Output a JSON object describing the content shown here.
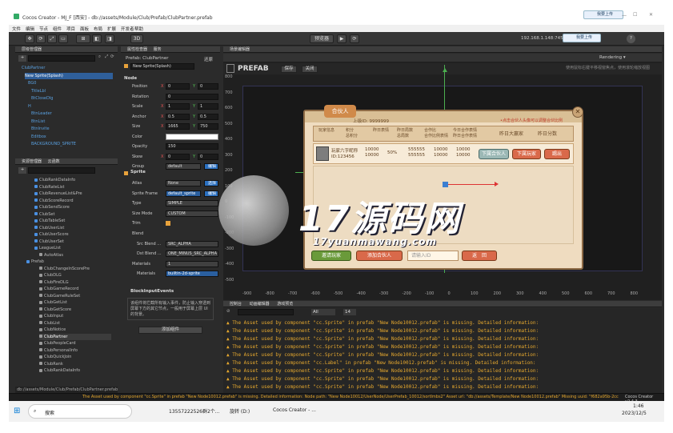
{
  "window": {
    "title": "Cocos Creator - MJ_F [西安] - db://assets/Module/Club/Prefab/ClubPartner.prefab",
    "upload1": "我要上传",
    "upload2": "我要上传"
  },
  "menu": [
    "文件",
    "编辑",
    "节点",
    "组件",
    "项目",
    "面板",
    "布局",
    "扩展",
    "开发者",
    "帮助"
  ],
  "toolbar": {
    "scene_btn": "预览器",
    "ip": "192.168.1.148:7456",
    "play": "▶",
    "refresh": "⟳",
    "zoom3d": "3D"
  },
  "node_tree": {
    "title": "层级管理器",
    "rows": [
      "ClubPartner",
      "New Sprite(Splash)",
      "BG0",
      "TitleLbl",
      "BtCloseDlg",
      "H",
      "BtnLeader",
      "BtnList",
      "BtnInvite",
      "Editbox",
      "BACKGROUND_SPRITE"
    ]
  },
  "assets": {
    "title": "资源管理器",
    "tab2": "云函数",
    "rows": [
      "ClubRankDataInfo",
      "ClubRateList",
      "ClubRevenueList&Pre",
      "ClubScoreRecord",
      "ClubSendScore",
      "ClubSet",
      "ClubTableSet",
      "ClubUserList",
      "ClubUserScore",
      "ClubUserSet",
      "LeagueList",
      "AutoAtlas",
      "Prefab",
      "ClubChangeInScorePre",
      "ClubDLG",
      "ClubFireDLG",
      "ClubGameRecord",
      "ClubGameRuleSet",
      "ClubGetList",
      "ClubGetScore",
      "ClubInput",
      "ClubList",
      "ClubNotice",
      "ClubPartner",
      "ClubPeopleCard",
      "ClubPersonalInfo",
      "ClubQuickJoin",
      "ClubRank",
      "ClubRankDataInfo"
    ],
    "path": "db://assets/Module/Club/Prefab/ClubPartner.prefab"
  },
  "inspector": {
    "tab1": "属性检查器",
    "tab2": "服务",
    "prefab_label": "Prefab: ClubPartner",
    "prefab_btn": "还原",
    "node_name": "New Sprite(Splash)",
    "node_section": "Node",
    "props": [
      {
        "k": "Position",
        "x": "0",
        "y": "0"
      },
      {
        "k": "Rotation",
        "v": "0"
      },
      {
        "k": "Scale",
        "x": "1",
        "y": "1"
      },
      {
        "k": "Anchor",
        "x": "0.5",
        "y": "0.5"
      },
      {
        "k": "Size",
        "x": "1665",
        "y": "750"
      },
      {
        "k": "Color",
        "v": ""
      },
      {
        "k": "Opacity",
        "v": "150"
      },
      {
        "k": "Skew",
        "x": "0",
        "y": "0"
      },
      {
        "k": "Group",
        "v": "default",
        "btn": "编辑"
      }
    ],
    "sprite_section": "Sprite",
    "sprite": [
      {
        "k": "Atlas",
        "v": "None",
        "btn": "选择"
      },
      {
        "k": "Sprite Frame",
        "v": "default_sprite",
        "btn": "编辑"
      },
      {
        "k": "Type",
        "v": "SIMPLE"
      },
      {
        "k": "Size Mode",
        "v": "CUSTOM"
      },
      {
        "k": "Trim",
        "v": ""
      },
      {
        "k": "Blend",
        "v": ""
      },
      {
        "k": "Src Blend ...",
        "v": "SRC_ALPHA"
      },
      {
        "k": "Dst Blend ...",
        "v": "ONE_MINUS_SRC_ALPHA"
      },
      {
        "k": "Materials",
        "v": "1"
      },
      {
        "k": "Materials",
        "v": "builtin-2d-sprite"
      }
    ],
    "block_section": "BlockInputEvents",
    "block_desc": "该组件将拦截所有输入事件，防止输入穿透到屏幕下方的其它节点，一般用于屏幕上层 UI 的背景。",
    "add_component": "添加组件"
  },
  "scene": {
    "title": "场景编辑器",
    "prefab_tag": "PREFAB",
    "save": "保存",
    "close": "关闭",
    "hint": "使用鼠标右键平移视窗焦点，使用滚轮缩放视图",
    "rendering": "Rendering ▾",
    "axis_x": [
      "-900",
      "-800",
      "-700",
      "-600",
      "-500",
      "-400",
      "-300",
      "-200",
      "-100",
      "0",
      "100",
      "200",
      "300",
      "400",
      "500",
      "600",
      "700",
      "800"
    ],
    "axis_y": [
      "800",
      "700",
      "600",
      "500",
      "400",
      "300",
      "200",
      "100",
      "0",
      "-100",
      "-200",
      "-300",
      "-400",
      "-500"
    ],
    "game": {
      "title": "合伙人",
      "upid": "上级ID: 9999999",
      "tip": "•点击合伙人头像可以调整合伙比例",
      "headers": [
        "玩家信息",
        "积分\n总积分",
        "昨日表情",
        "昨日局数\n总局数",
        "合作比\n合作比例表情",
        "今日合作表情\n昨日合作表情",
        "昨日大赢家",
        "昨日分数"
      ],
      "row": {
        "name": "玩家六字昵称",
        "id": "ID:123456",
        "c1": "10000\n10000",
        "c2": "50%",
        "c3": "555555\n555555",
        "c4": "10000\n10000",
        "c5": "10000\n10000"
      },
      "btn_a": "下属合伙人",
      "btn_b": "下属玩家",
      "btn_c": "踢出",
      "bottom": [
        "邀请玩家",
        "添加合伙人",
        "请输入ID",
        "返　回"
      ]
    }
  },
  "console": {
    "tab1": "控制台",
    "tab2": "动画编辑器",
    "tab3": "游戏预览",
    "filter": "All",
    "fontsize": "14",
    "lines": [
      "The Asset used by component \"cc.Sprite\" in prefab \"New Node10012.prefab\" is missing. Detailed information:",
      "The Asset used by component \"cc.Sprite\" in prefab \"New Node10012.prefab\" is missing. Detailed information:",
      "The Asset used by component \"cc.Sprite\" in prefab \"New Node10012.prefab\" is missing. Detailed information:",
      "The Asset used by component \"cc.Sprite\" in prefab \"New Node10012.prefab\" is missing. Detailed information:",
      "The Asset used by component \"cc.Sprite\" in prefab \"New Node10012.prefab\" is missing. Detailed information:",
      "The Asset used by component \"cc.Label\" in prefab \"New Node10012.prefab\" is missing. Detailed information:",
      "The Asset used by component \"cc.Sprite\" in prefab \"New Node10012.prefab\" is missing. Detailed information:",
      "The Asset used by component \"cc.Sprite\" in prefab \"New Node10012.prefab\" is missing. Detailed information:",
      "The Asset used by component \"cc.Sprite\" in prefab \"New Node10012.prefab\" is missing. Detailed information:"
    ]
  },
  "statusbar": {
    "text": "The Asset used by component \"cc.Sprite\" in prefab \"New Node10012.prefab\" is missing. Detailed information: Node path: \"New Node10012/UserNode/UserPrefab_10012/sortImbs2\" Asset url: \"db://assets/Template/New Node10012.prefab\" Missing uuid: \"f682a95b-2cc3-4234-ac0b-6fcd4f5f5f00\"",
    "version": "Cocos Creator v2.4.3"
  },
  "watermark": {
    "big": "17源码网",
    "small": "17yuanmawang.com"
  },
  "taskbar": {
    "search": "搜索",
    "app1": "13557222526群2个...",
    "app2": "旋转 (D:)",
    "app3": "Cocos Creator - ...",
    "time": "1:46",
    "date": "2023/12/5"
  }
}
